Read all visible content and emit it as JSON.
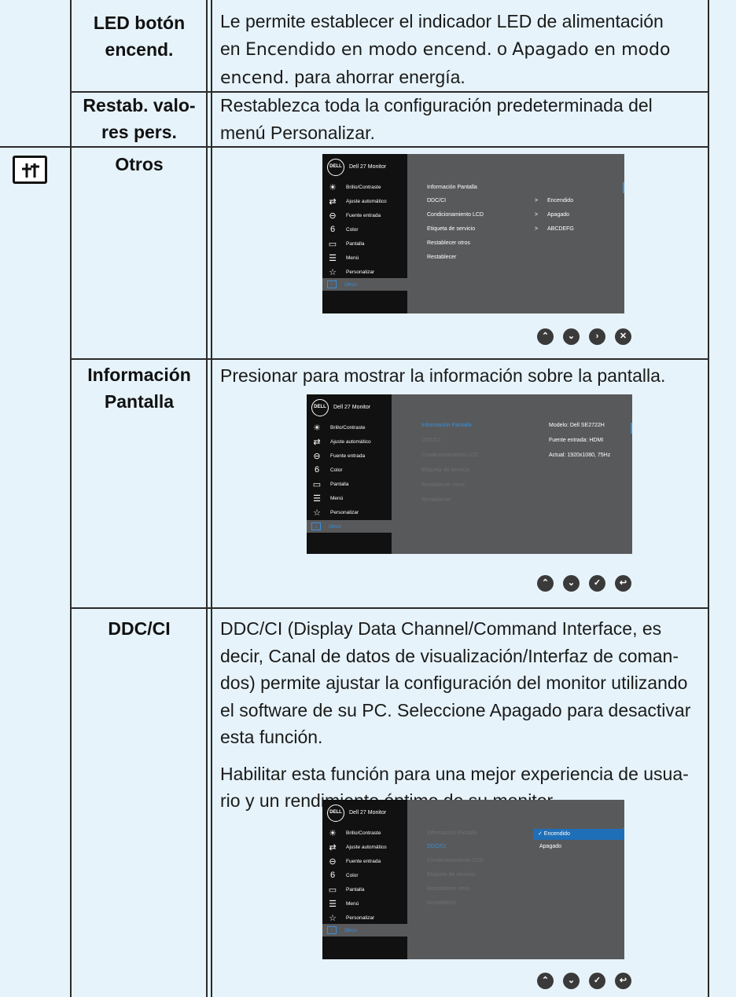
{
  "rows": {
    "led": {
      "label_line1": "LED botón",
      "label_line2": "encend.",
      "text_a": "Le permite establecer el indicador LED de alimentación",
      "text_b_prefix": "en ",
      "text_b_em1": "Encendido en modo encend.",
      "text_b_mid": " o ",
      "text_b_em2": "Apagado en modo",
      "text_c_em": "encend.",
      "text_c_suffix": " para ahorrar energía."
    },
    "restab": {
      "label_line1": "Restab. valo-",
      "label_line2": "res pers.",
      "text_a": "Restablezca toda la configuración predeterminada del",
      "text_b": "menú Personalizar."
    },
    "otros": {
      "label": "Otros"
    },
    "info": {
      "label_line1": "Información",
      "label_line2": "Pantalla",
      "text": "Presionar para mostrar la información sobre la pantalla."
    },
    "ddc": {
      "label": "DDC/CI",
      "p1_l1": "DDC/CI (Display Data Channel/Command Interface, es",
      "p1_l2": "decir, Canal de datos de visualización/Interfaz de coman-",
      "p1_l3": "dos) permite ajustar la configuración del monitor utilizando",
      "p1_l4": "el software de su PC. Seleccione Apagado para desactivar",
      "p1_l5": "esta función.",
      "p2_l1": "Habilitar esta función para una mejor experiencia de usua-",
      "p2_l2": "rio y un rendimiento óptimo de su monitor."
    }
  },
  "osd": {
    "logo": "DELL",
    "title": "Dell 27 Monitor",
    "menu": [
      "Brillo/Contraste",
      "Ajuste automático",
      "Fuente entrada",
      "Color",
      "Pantalla",
      "Menú",
      "Personalizar",
      "Otros"
    ],
    "submenu": [
      "Información Pantalla",
      "DDC/CI",
      "Condicionamiento LCD",
      "Etiqueta de servicio",
      "Restablecer otros",
      "Restablecer"
    ],
    "values1": [
      "Encendido",
      "Apagado",
      "ABCDEFG"
    ],
    "values2": [
      "Modelo: Dell SE2722H",
      "Fuente entrada: HDMI",
      "Actual: 1920x1080, 75Hz"
    ],
    "values3": [
      "✓ Encendido",
      "Apagado"
    ],
    "accent": "#3a8fd8"
  }
}
